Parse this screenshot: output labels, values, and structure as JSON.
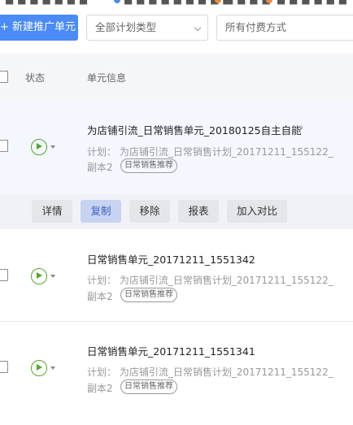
{
  "toolbar": {
    "new_unit_label": "+ 新建推广单元",
    "plan_type_select": "全部计划类型",
    "payment_select": "所有付费方式"
  },
  "table": {
    "headers": {
      "status": "状态",
      "unit_info": "单元信息"
    }
  },
  "actions": {
    "details": "详情",
    "copy": "复制",
    "move": "移除",
    "report": "报表",
    "compare": "加入对比"
  },
  "rows": [
    {
      "name": "为店铺引流_日常销售单元_20180125自主自能",
      "plan": "计划： 为店铺引流_日常销售计划_20171211_155122_",
      "plan_suffix": "副本2",
      "tag": "日常销售推荐"
    },
    {
      "name": "日常销售单元_20171211_1551342",
      "plan": "计划： 为店铺引流_日常销售计划_20171211_155122_",
      "plan_suffix": "副本2",
      "tag": "日常销售推荐"
    },
    {
      "name": "日常销售单元_20171211_1551341",
      "plan": "计划： 为店铺引流_日常销售计划_20171211_155122_",
      "plan_suffix": "副本2",
      "tag": "日常销售推荐"
    }
  ]
}
